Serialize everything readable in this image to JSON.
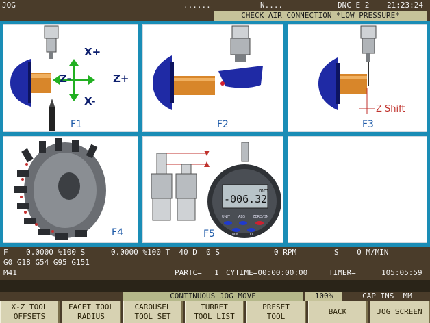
{
  "status_bar": {
    "mode": "JOG",
    "dots": "......",
    "program_indicator": "N....",
    "dnc": "DNC E 2",
    "clock": "21:23:24"
  },
  "alarm_message": "CHECK AIR CONNECTION *LOW PRESSURE*",
  "panels": [
    {
      "key": "F1",
      "label": "F1",
      "axis_labels": {
        "x_plus": "X+",
        "x_minus": "X-",
        "z_plus": "Z+",
        "z_minus": "Z-"
      }
    },
    {
      "key": "F2",
      "label": "F2"
    },
    {
      "key": "F3",
      "label": "F3",
      "annotation": "Z Shift"
    },
    {
      "key": "F4",
      "label": "F4"
    },
    {
      "key": "F5",
      "label": "F5",
      "gauge_reading": "-006.32",
      "gauge_unit": "mm",
      "gauge_buttons": [
        "UNIT",
        "ABS",
        "ZERO/ON",
        "MIN",
        "TOL"
      ]
    },
    {
      "key": "F6",
      "label": ""
    }
  ],
  "machine_status": {
    "line1": {
      "feed": "F    0.0000 %100 S",
      "spindle": "0.0000 %100 T  40 D  0 S",
      "rpm": "0 RPM",
      "surface": "S    0 M/MIN"
    },
    "line2": "G0 G18 G54 G95 G151",
    "line3": {
      "m_code": "M41",
      "parts": "PARTC=",
      "parts_count": "1",
      "cycle_time": "CYTIME=00:00:00:00",
      "timer_label": "TIMER=",
      "timer_value": "105:05:59"
    }
  },
  "mode_bar": {
    "jog_mode": "CONTINUOUS JOG MOVE",
    "override": "100%",
    "indicators": "CAP INS  MM"
  },
  "softkeys": [
    {
      "line1": "X-Z TOOL",
      "line2": "OFFSETS"
    },
    {
      "line1": "FACET TOOL",
      "line2": "RADIUS"
    },
    {
      "line1": "CAROUSEL",
      "line2": "TOOL SET"
    },
    {
      "line1": "TURRET",
      "line2": "TOOL LIST"
    },
    {
      "line1": "PRESET",
      "line2": "TOOL"
    },
    {
      "line1": "BACK",
      "line2": ""
    },
    {
      "line1": "JOG SCREEN",
      "line2": ""
    }
  ],
  "colors": {
    "background": "#4a3c2a",
    "panel_frame": "#1a8db6",
    "alarm_bg": "#c6c39a",
    "mode_bar_bg": "#b5b88a",
    "softkey_bg": "#d7d2b2",
    "label_blue": "#1d5aa8",
    "chuck_blue": "#1f2aa5",
    "part_orange": "#d8862a",
    "arrow_green": "#22b022",
    "shift_red": "#c0322c"
  }
}
